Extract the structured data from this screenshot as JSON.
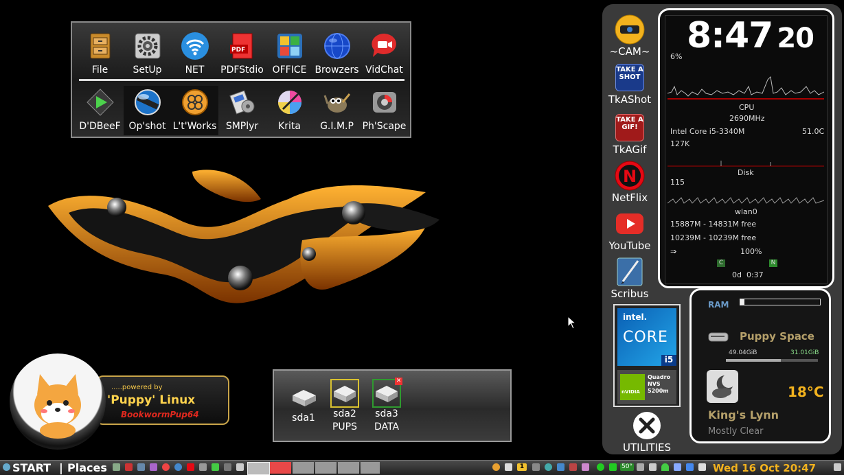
{
  "launcher": {
    "row1": [
      {
        "label": "File",
        "icon": "file-cabinet-icon"
      },
      {
        "label": "SetUp",
        "icon": "gear-icon"
      },
      {
        "label": "NET",
        "icon": "wifi-icon"
      },
      {
        "label": "PDFStdio",
        "icon": "pdf-icon"
      },
      {
        "label": "OFFICE",
        "icon": "office-icon"
      },
      {
        "label": "Browzers",
        "icon": "globe-icon"
      },
      {
        "label": "VidChat",
        "icon": "video-chat-icon"
      }
    ],
    "row2": [
      {
        "label": "D'DBeeF",
        "icon": "play-icon"
      },
      {
        "label": "Op'shot",
        "icon": "screenshot-icon"
      },
      {
        "label": "L't'Works",
        "icon": "libreworks-icon"
      },
      {
        "label": "SMPlyr",
        "icon": "media-player-icon"
      },
      {
        "label": "Krita",
        "icon": "krita-icon"
      },
      {
        "label": "G.I.M.P",
        "icon": "gimp-icon"
      },
      {
        "label": "Ph'Scape",
        "icon": "photoscape-icon"
      }
    ]
  },
  "badge": {
    "powered": ".....powered by",
    "title": "'Puppy' Linux",
    "sub": "BookwormPup64"
  },
  "drives": [
    {
      "name": "sda1",
      "sub": "",
      "icon": "drive-icon"
    },
    {
      "name": "sda2",
      "sub": "PUPS",
      "icon": "drive-icon"
    },
    {
      "name": "sda3",
      "sub": "DATA",
      "icon": "drive-icon"
    }
  ],
  "dock": {
    "items": [
      {
        "label": "~CAM~",
        "icon": "webcam-icon"
      },
      {
        "label": "TkAShot",
        "icon": "take-a-shot-icon",
        "badge": "TAKE A SHOT"
      },
      {
        "label": "TkAGif",
        "icon": "take-a-gif-icon",
        "badge": "TAKE A GIF!"
      },
      {
        "label": "NetFlix",
        "icon": "netflix-icon"
      },
      {
        "label": "YouTube",
        "icon": "youtube-icon"
      },
      {
        "label": "Scribus",
        "icon": "scribus-icon"
      }
    ],
    "utilities": "UTILITIES",
    "intel": {
      "brand": "intel.",
      "line": "CORE",
      "model": "i5"
    },
    "nvidia": {
      "brand": "nVIDIA",
      "model": "Quadro NVS 5200m"
    }
  },
  "sysmon": {
    "time": "8:47",
    "seconds": "20",
    "cpu_percent": "6%",
    "cpu_label": "CPU",
    "cpu_freq": "2690MHz",
    "cpu_model": "Intel Core i5-3340M",
    "cpu_temp": "51.0C",
    "disk_rate": "127K",
    "disk_label": "Disk",
    "net_rate": "115",
    "net_label": "wlan0",
    "mem1": "15887M - 14831M free",
    "mem2": "10239M - 10239M free",
    "battery": "100%",
    "caps": "C",
    "num": "N",
    "uptime": "0d  0:37"
  },
  "weather": {
    "ram_label": "RAM",
    "ram_fraction": 0.05,
    "space_label": "Puppy Space",
    "space_used": "49.04GiB",
    "space_free": "31.01GiB",
    "space_fraction": 0.6,
    "temp": "18°C",
    "city": "King's Lynn",
    "condition": "Mostly Clear"
  },
  "taskbar": {
    "start": "START",
    "places": "Places",
    "volume": "50°",
    "datetime": "Wed 16 Oct 20:47",
    "tray_badge": "1"
  }
}
